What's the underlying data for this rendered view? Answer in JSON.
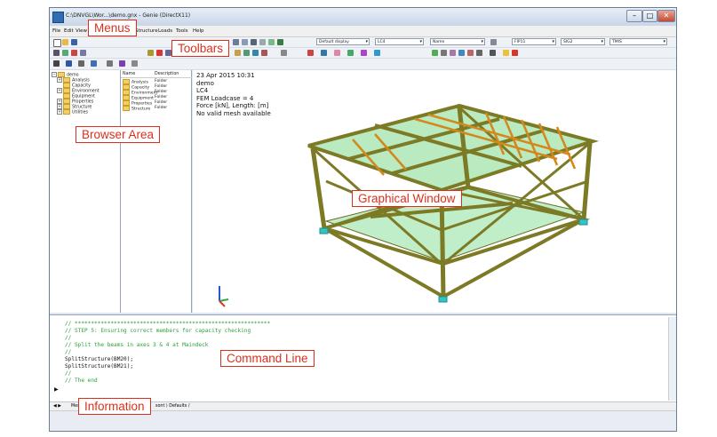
{
  "window": {
    "title": "C:\\DNVGL\\Wor...\\demo.gnx - Genie (DirectX11)"
  },
  "menu": [
    "File",
    "Edit",
    "View",
    "Structure",
    "Loads",
    "Tools",
    "Help"
  ],
  "toolbar": {
    "display_dropdown": "Default display",
    "loadcase_dropdown": "LC4",
    "name_dropdown": "Name",
    "field1": "FIP11",
    "field2": "SIG2",
    "field3": "TMIS"
  },
  "browser": {
    "tree": [
      "demo",
      "Analysis",
      "Capacity",
      "Environment",
      "Equipment",
      "Properties",
      "Structure",
      "Utilities"
    ],
    "list_headers": [
      "Name",
      "Description"
    ],
    "list_rows": [
      {
        "name": "Analysis",
        "desc": "Folder"
      },
      {
        "name": "Capacity",
        "desc": "Folder"
      },
      {
        "name": "Environment",
        "desc": "Folder"
      },
      {
        "name": "Equipment",
        "desc": "Folder"
      },
      {
        "name": "Properties",
        "desc": "Folder"
      },
      {
        "name": "Structure",
        "desc": "Folder"
      }
    ]
  },
  "graphics": {
    "info": [
      "23 Apr 2015 10:31",
      "demo",
      "LC4",
      "FEM Loadcase = 4",
      "Force [kN], Length: [m]",
      "No valid mesh available"
    ]
  },
  "command_lines": [
    {
      "text": "// ************************************************************",
      "color": "green"
    },
    {
      "text": "// STEP 5: Ensuring correct members for capacity checking",
      "color": "green"
    },
    {
      "text": "//",
      "color": "green"
    },
    {
      "text": "// Split the beams in axes 3 & 4 at Maindeck",
      "color": "green"
    },
    {
      "text": "//",
      "color": "green"
    },
    {
      "text": "SplitStructure(BM20);",
      "color": "black"
    },
    {
      "text": "SplitStructure(BM21);",
      "color": "black"
    },
    {
      "text": "//",
      "color": "green"
    },
    {
      "text": "// The end",
      "color": "green"
    }
  ],
  "bottom_tabs": {
    "left": "Mes",
    "right": "sont ⟩ Defaults /"
  },
  "callouts": {
    "menus": "Menus",
    "toolbars": "Toolbars",
    "browser": "Browser Area",
    "graphical": "Graphical Window",
    "command": "Command Line",
    "information": "Information"
  },
  "colors": {
    "callout": "#d9301e",
    "comment_green": "#2e9e3b",
    "beam_olive": "#7d7a26",
    "plate_green": "#56d06a",
    "deck_orange": "#d4881c"
  }
}
